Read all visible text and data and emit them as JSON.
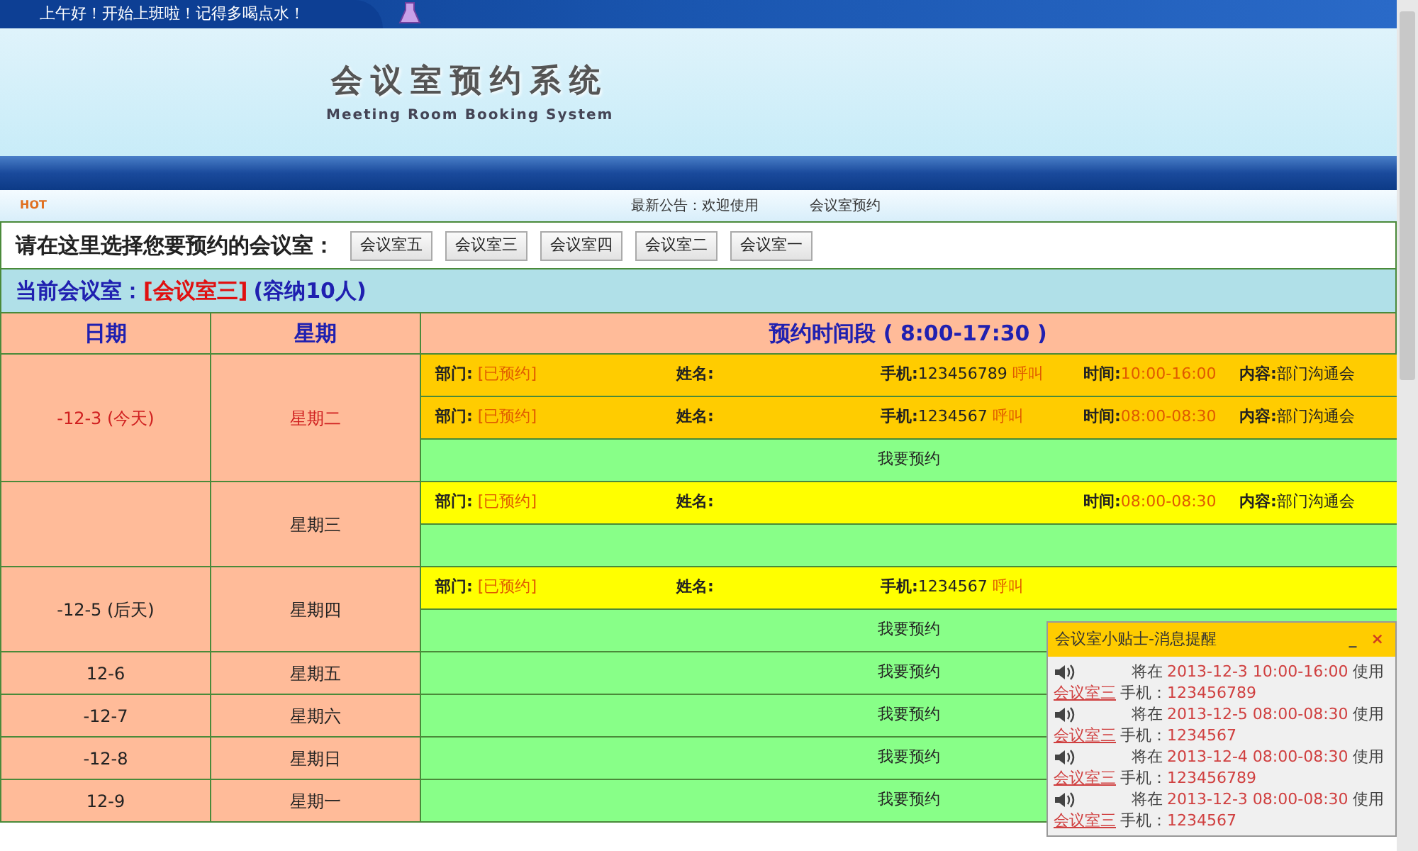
{
  "top_bar": {
    "greeting": "上午好！开始上班啦！记得多喝点水！"
  },
  "banner": {
    "title": "会议室预约系统",
    "subtitle": "Meeting Room Booking System"
  },
  "nav": {
    "badge": "HOT",
    "notice": "最新公告：欢迎使用",
    "link": "会议室预约"
  },
  "room_picker": {
    "prompt": "请在这里选择您要预约的会议室：",
    "rooms": [
      "会议室五",
      "会议室三",
      "会议室四",
      "会议室二",
      "会议室一"
    ]
  },
  "current_room": {
    "label": "当前会议室：",
    "room": "[会议室三]",
    "capacity": "(容纳10人)"
  },
  "table": {
    "columns": [
      "日期",
      "星期",
      "预约时间段 ( 8:00-17:30 )"
    ],
    "days": [
      {
        "date": "-12-3 (今天)",
        "weekday": "星期二",
        "today": true,
        "slots": [
          {
            "kind": "booking",
            "color": "#ffcc00",
            "dept_label": "部门:",
            "dept": "[已预约]",
            "name_label": "姓名:",
            "phone_label": "手机:",
            "phone": "123456789",
            "call": "呼叫",
            "time_label": "时间:",
            "time": "10:00-16:00",
            "content_label": "内容:",
            "content": "部门沟通会"
          },
          {
            "kind": "booking",
            "color": "#ffcc00",
            "dept_label": "部门:",
            "dept": "[已预约]",
            "name_label": "姓名:",
            "phone_label": "手机:",
            "phone": "1234567",
            "call": "呼叫",
            "time_label": "时间:",
            "time": "08:00-08:30",
            "content_label": "内容:",
            "content": "部门沟通会"
          },
          {
            "kind": "free",
            "label": "我要预约"
          }
        ]
      },
      {
        "weekday": "星期三",
        "today": false,
        "slots": [
          {
            "kind": "booking",
            "color": "#ffff00",
            "dept_label": "部门:",
            "dept": "[已预约]",
            "name_label": "姓名:",
            "time_label": "时间:",
            "time": "08:00-08:30",
            "content_label": "内容:",
            "content": "部门沟通会"
          },
          {
            "kind": "free"
          }
        ]
      },
      {
        "date": "-12-5 (后天)",
        "weekday": "星期四",
        "today": false,
        "slots": [
          {
            "kind": "booking",
            "color": "#ffff00",
            "dept_label": "部门:",
            "dept": "[已预约]",
            "name_label": "姓名:",
            "phone_label": "手机:",
            "phone": "1234567",
            "call": "呼叫"
          },
          {
            "kind": "free",
            "label": "我要预约"
          }
        ]
      },
      {
        "date": "12-6",
        "weekday": "星期五",
        "today": false,
        "slots": [
          {
            "kind": "free",
            "label": "我要预约"
          }
        ]
      },
      {
        "date": "-12-7",
        "weekday": "星期六",
        "today": false,
        "slots": [
          {
            "kind": "free",
            "label": "我要预约"
          }
        ]
      },
      {
        "date": "-12-8",
        "weekday": "星期日",
        "today": false,
        "slots": [
          {
            "kind": "free",
            "label": "我要预约"
          }
        ]
      },
      {
        "date": "12-9",
        "weekday": "星期一",
        "today": false,
        "slots": [
          {
            "kind": "free",
            "label": "我要预约"
          }
        ]
      }
    ]
  },
  "popup": {
    "title": "会议室小贴士-消息提醒",
    "minimize": "_",
    "close": "×",
    "messages": [
      {
        "prefix": "将在",
        "when": "2013-12-3 10:00-16:00",
        "suffix": "使用",
        "room": "会议室三",
        "phone_label": "手机：",
        "phone": "123456789"
      },
      {
        "prefix": "将在",
        "when": "2013-12-5 08:00-08:30",
        "suffix": "使用",
        "room": "会议室三",
        "phone_label": "手机：",
        "phone": "1234567"
      },
      {
        "prefix": "将在",
        "when": "2013-12-4 08:00-08:30",
        "suffix": "使用",
        "room": "会议室三",
        "phone_label": "手机：",
        "phone": "123456789"
      },
      {
        "prefix": "将在",
        "when": "2013-12-3 08:00-08:30",
        "suffix": "使用",
        "room": "会议室三",
        "phone_label": "手机：",
        "phone": "1234567"
      }
    ]
  }
}
